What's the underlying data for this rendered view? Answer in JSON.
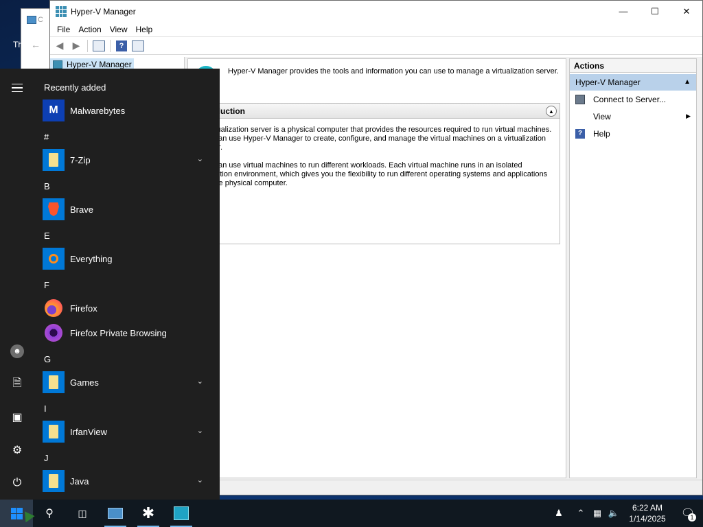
{
  "desktop": {
    "back_window_title": "C",
    "desk_text": "Th"
  },
  "hyperv": {
    "title": "Hyper-V Manager",
    "menu": [
      "File",
      "Action",
      "View",
      "Help"
    ],
    "tree_item": "Hyper-V Manager",
    "header_text": "Hyper-V Manager provides the tools and information you can use to manage a virtualization server.",
    "intro_title": "Introduction",
    "intro_paragraphs": [
      "A virtualization server is a physical computer that provides the resources required to run virtual machines. You can use Hyper-V Manager to create, configure, and manage the virtual machines on a virtualization server.",
      "You can use virtual machines to run different workloads. Each virtual machine runs in an isolated execution environment, which gives you the flexibility to run different operating systems and applications on one physical computer."
    ],
    "actions": {
      "title": "Actions",
      "group": "Hyper-V Manager",
      "items": [
        "Connect to Server...",
        "View",
        "Help"
      ]
    }
  },
  "start_menu": {
    "recently_added_label": "Recently added",
    "apps": [
      {
        "section": "",
        "name": "Malwarebytes",
        "expandable": false
      },
      {
        "section": "#",
        "name": "7-Zip",
        "expandable": true
      },
      {
        "section": "B",
        "name": "Brave",
        "expandable": false
      },
      {
        "section": "E",
        "name": "Everything",
        "expandable": false
      },
      {
        "section": "F",
        "name": "Firefox",
        "expandable": false
      },
      {
        "section": "",
        "name": "Firefox Private Browsing",
        "expandable": false
      },
      {
        "section": "G",
        "name": "Games",
        "expandable": true
      },
      {
        "section": "I",
        "name": "IrfanView",
        "expandable": true
      },
      {
        "section": "J",
        "name": "Java",
        "expandable": true
      }
    ]
  },
  "taskbar": {
    "time": "6:22 AM",
    "date": "1/14/2025",
    "notification_count": "1"
  },
  "colors": {
    "accent": "#0078d7",
    "start_bg": "#1f1f1f",
    "taskbar_bg": "#101820",
    "actions_group_bg": "#b9d1ea"
  }
}
